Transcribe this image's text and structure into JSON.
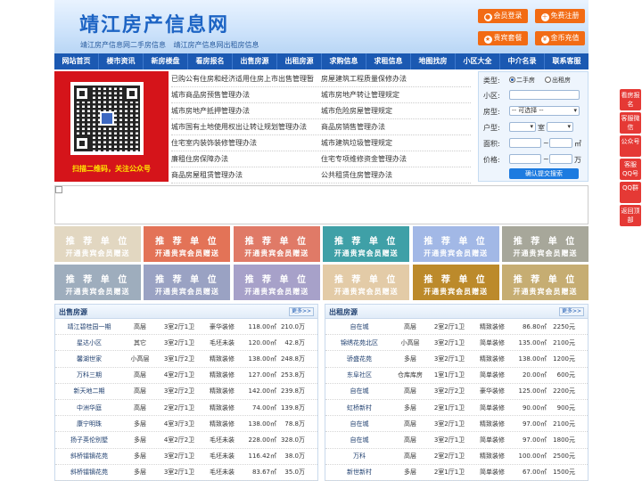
{
  "header": {
    "title": "靖江房产信息网",
    "links": [
      "靖江房产信息网二手房信息",
      "靖江房产信息网出租房信息"
    ],
    "buttons": [
      {
        "label": "会员登录",
        "icon": "user-icon"
      },
      {
        "label": "免费注册",
        "icon": "register-icon"
      },
      {
        "label": "贵宾套餐",
        "icon": "vip-icon"
      },
      {
        "label": "金币充值",
        "icon": "coin-icon"
      }
    ]
  },
  "nav": [
    "网站首页",
    "楼市资讯",
    "新房楼盘",
    "看房报名",
    "出售房源",
    "出租房源",
    "求购信息",
    "求租信息",
    "地图找房",
    "小区大全",
    "中介名录",
    "联系客服"
  ],
  "qr": {
    "caption": "扫描二维码，关注公众号"
  },
  "policy": [
    [
      "已购公有住房和经济适用住房上市出售管理暂",
      "房屋建筑工程质量保修办法"
    ],
    [
      "城市商品房预售管理办法",
      "城市房地产转让管理规定"
    ],
    [
      "城市房地产抵押管理办法",
      "城市危险房屋管理规定"
    ],
    [
      "城市国有土地使用权出让转让规划管理办法",
      "商品房销售管理办法"
    ],
    [
      "住宅室内装饰装修管理办法",
      "城市建筑垃圾管理规定"
    ],
    [
      "廉租住房保障办法",
      "住宅专项维修资金管理办法"
    ],
    [
      "商品房屋租赁管理办法",
      "公共租赁住房管理办法"
    ]
  ],
  "search": {
    "type_label": "类型:",
    "opt_sale": "二手房",
    "opt_rent": "出租房",
    "community_label": "小区:",
    "house_type_label": "房型:",
    "house_type_value": "-- 可选择 --",
    "layout_label": "户型:",
    "room_unit": "室",
    "area_label": "面积:",
    "area_unit": "㎡",
    "price_label": "价格:",
    "price_unit": "万",
    "range_sep": "~",
    "button": "确认提交搜索"
  },
  "ads": [
    {
      "t1": "推 荐 单 位",
      "t2": "开通贵宾会员赠送",
      "color": "#e2d7c1"
    },
    {
      "t1": "推 荐 单 位",
      "t2": "开通贵宾会员赠送",
      "color": "#e37357"
    },
    {
      "t1": "推 荐 单 位",
      "t2": "开通贵宾会员赠送",
      "color": "#e07a67"
    },
    {
      "t1": "推 荐 单 位",
      "t2": "开通贵宾会员赠送",
      "color": "#3fa0a7"
    },
    {
      "t1": "推 荐 单 位",
      "t2": "开通贵宾会员赠送",
      "color": "#a2b8e6"
    },
    {
      "t1": "推 荐 单 位",
      "t2": "开通贵宾会员赠送",
      "color": "#a7a79a"
    },
    {
      "t1": "推 荐 单 位",
      "t2": "开通贵宾会员赠送",
      "color": "#9eadbd"
    },
    {
      "t1": "推 荐 单 位",
      "t2": "开通贵宾会员赠送",
      "color": "#9aa2c3"
    },
    {
      "t1": "推 荐 单 位",
      "t2": "开通贵宾会员赠送",
      "color": "#a7a1c9"
    },
    {
      "t1": "推 荐 单 位",
      "t2": "开通贵宾会员赠送",
      "color": "#e3cba7"
    },
    {
      "t1": "推 荐 单 位",
      "t2": "开通贵宾会员赠送",
      "color": "#bc8a2b"
    },
    {
      "t1": "推 荐 单 位",
      "t2": "开通贵宾会员赠送",
      "color": "#c6ad72"
    }
  ],
  "sale": {
    "title": "出售房源",
    "more": "更多>>",
    "rows": [
      [
        "靖江碧桂园一期",
        "高层",
        "3室2厅1卫",
        "豪华装修",
        "118.00㎡",
        "210.0万"
      ],
      [
        "星达小区",
        "其它",
        "3室2厅1卫",
        "毛坯未装",
        "120.00㎡",
        "42.8万"
      ],
      [
        "馨湖世家",
        "小高层",
        "3室1厅2卫",
        "精致装修",
        "138.00㎡",
        "248.8万"
      ],
      [
        "万科三期",
        "高层",
        "4室2厅1卫",
        "精致装修",
        "127.00㎡",
        "253.8万"
      ],
      [
        "新天地二期",
        "高层",
        "3室2厅2卫",
        "精致装修",
        "142.00㎡",
        "239.8万"
      ],
      [
        "中洲华庭",
        "高层",
        "2室2厅1卫",
        "精致装修",
        "74.00㎡",
        "139.8万"
      ],
      [
        "康宁明珠",
        "多层",
        "4室3厅3卫",
        "精致装修",
        "138.00㎡",
        "78.8万"
      ],
      [
        "扬子英伦别墅",
        "多层",
        "4室2厅2卫",
        "毛坯未装",
        "228.00㎡",
        "328.0万"
      ],
      [
        "斜桥镭镝花苑",
        "多层",
        "3室2厅1卫",
        "毛坯未装",
        "116.42㎡",
        "38.0万"
      ],
      [
        "斜桥镭镝花苑",
        "多层",
        "3室2厅1卫",
        "毛坯未装",
        "83.67㎡",
        "35.0万"
      ]
    ]
  },
  "rent": {
    "title": "出租房源",
    "more": "更多>>",
    "rows": [
      [
        "自在城",
        "高层",
        "2室2厅1卫",
        "精致装修",
        "86.80㎡",
        "2250元"
      ],
      [
        "锦绣花苑北区",
        "小高层",
        "3室2厅1卫",
        "简单装修",
        "135.00㎡",
        "2100元"
      ],
      [
        "骄盛花苑",
        "多层",
        "3室2厅1卫",
        "精致装修",
        "138.00㎡",
        "1200元"
      ],
      [
        "东阜社区",
        "仓库库房",
        "1室1厅1卫",
        "简单装修",
        "20.00㎡",
        "600元"
      ],
      [
        "自在城",
        "高层",
        "3室2厅2卫",
        "豪华装修",
        "125.00㎡",
        "2200元"
      ],
      [
        "虹桥新村",
        "多层",
        "2室1厅1卫",
        "简单装修",
        "90.00㎡",
        "900元"
      ],
      [
        "自在城",
        "高层",
        "3室2厅1卫",
        "精致装修",
        "97.00㎡",
        "2100元"
      ],
      [
        "自在城",
        "高层",
        "3室2厅1卫",
        "简单装修",
        "97.00㎡",
        "1800元"
      ],
      [
        "万科",
        "高层",
        "2室2厅1卫",
        "精致装修",
        "100.00㎡",
        "2500元"
      ],
      [
        "新世新村",
        "多层",
        "2室1厅1卫",
        "简单装修",
        "67.00㎡",
        "1500元"
      ]
    ]
  },
  "side_tabs": [
    "看房报名",
    "客服微信",
    "公众号",
    "客服QQ号",
    "QQ群",
    "返回顶部"
  ]
}
